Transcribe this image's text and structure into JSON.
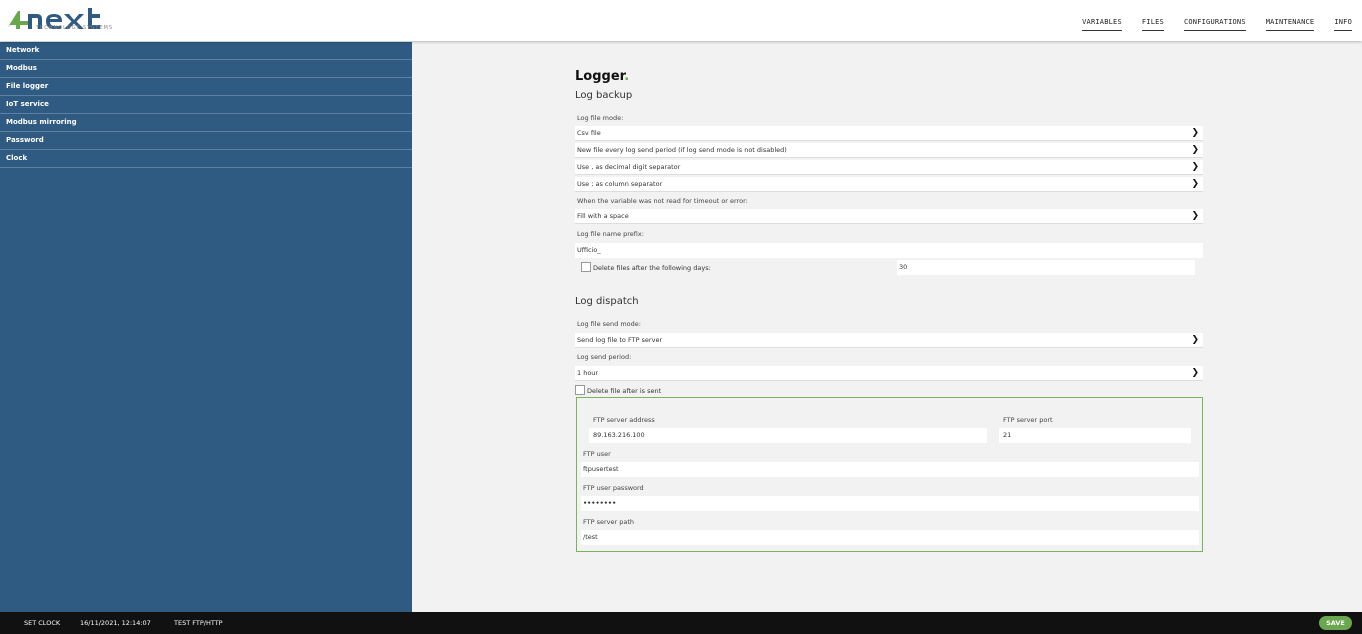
{
  "header": {
    "logo_subtitle": "TECHNOLOGY SYSTEMS",
    "nav": [
      "VARIABLES",
      "FILES",
      "CONFIGURATIONS",
      "MAINTENANCE",
      "INFO"
    ]
  },
  "sidebar": {
    "items": [
      {
        "label": "Network"
      },
      {
        "label": "Modbus"
      },
      {
        "label": "File logger"
      },
      {
        "label": "IoT service"
      },
      {
        "label": "Modbus mirroring"
      },
      {
        "label": "Password"
      },
      {
        "label": "Clock"
      }
    ]
  },
  "page": {
    "title": "Logger",
    "title_dot": "."
  },
  "backup": {
    "section_title": "Log backup",
    "mode_label": "Log file mode:",
    "mode_value": "Csv file",
    "new_file_value": "New file every log send period (if log send mode is not disabled)",
    "decimal_value": "Use , as decimal digit separator",
    "column_value": "Use ; as column separator",
    "not_read_label": "When the variable was not read for timeout or error:",
    "fill_value": "Fill with a space",
    "prefix_label": "Log file name prefix:",
    "prefix_value": "Ufficio_",
    "delete_days_label": "Delete files after the following days:",
    "delete_days_value": "30"
  },
  "dispatch": {
    "section_title": "Log dispatch",
    "send_mode_label": "Log file send mode:",
    "send_mode_value": "Send log file to FTP server",
    "period_label": "Log send period:",
    "period_value": "1 hour",
    "delete_after_label": "Delete file after is sent"
  },
  "ftp": {
    "address_label": "FTP server address",
    "address_value": "89.163.216.100",
    "port_label": "FTP server port",
    "port_value": "21",
    "user_label": "FTP user",
    "user_value": "ftpusertest",
    "password_label": "FTP user password",
    "password_value": "••••••••",
    "path_label": "FTP server path",
    "path_value": "/test"
  },
  "footer": {
    "set_clock": "SET CLOCK",
    "datetime": "16/11/2021, 12:14:07",
    "test": "TEST FTP/HTTP",
    "save": "SAVE"
  },
  "colors": {
    "sidebar": "#2f5b82",
    "accent_green": "#6aa84f",
    "footer": "#111111"
  }
}
